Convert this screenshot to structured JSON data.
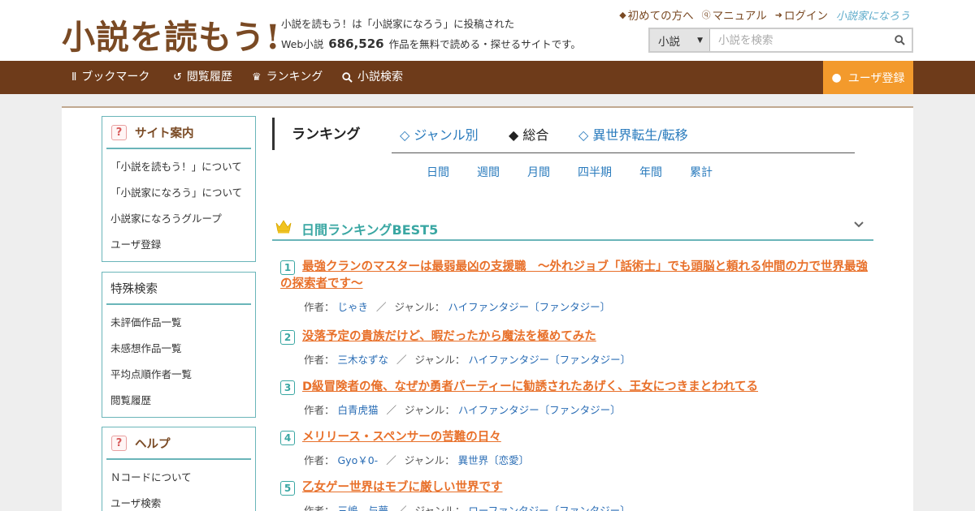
{
  "header": {
    "logo": "小説を読もう!",
    "tagline_line1": "小説を読もう！は「小説家になろう」に投稿された",
    "tagline_prefix": "Web小説",
    "tagline_count": "686,526",
    "tagline_suffix": "作品を無料で読める・探せるサイトです。",
    "toplinks": [
      {
        "label": "初めての方へ",
        "icon": "shield-icon"
      },
      {
        "label": "マニュアル",
        "icon": "question-icon"
      },
      {
        "label": "ログイン",
        "icon": "login-icon"
      }
    ],
    "narou_logo": "小説家になろう",
    "search": {
      "select_value": "小説",
      "placeholder": "小説を検索"
    }
  },
  "nav": {
    "items": [
      {
        "label": "ブックマーク",
        "icon": "bookmark-icon"
      },
      {
        "label": "閲覧履歴",
        "icon": "history-icon"
      },
      {
        "label": "ランキング",
        "icon": "crown-icon"
      },
      {
        "label": "小説検索",
        "icon": "search-icon"
      }
    ],
    "register": "ユーザ登録"
  },
  "sidebar": {
    "boxes": [
      {
        "title": "サイト案内",
        "items": [
          "「小説を読もう！」について",
          "「小説家になろう」について",
          "小説家になろうグループ",
          "ユーザ登録"
        ]
      },
      {
        "title": "特殊検索",
        "items": [
          "未評価作品一覧",
          "未感想作品一覧",
          "平均点順作者一覧",
          "閲覧履歴"
        ]
      },
      {
        "title": "ヘルプ",
        "items": [
          "Ｎコードについて",
          "ユーザ検索"
        ]
      }
    ]
  },
  "content": {
    "title": "ランキング",
    "tabs": [
      {
        "label": "◇ ジャンル別",
        "active": false
      },
      {
        "label": "◆ 総合",
        "active": true
      },
      {
        "label": "◇ 異世界転生/転移",
        "active": false
      }
    ],
    "periods": [
      "日間",
      "週間",
      "月間",
      "四半期",
      "年間",
      "累計"
    ],
    "ranking_title": "日間ランキングBEST5",
    "author_label": "作者：",
    "genre_label": "ジャンル：",
    "entries": [
      {
        "rank": "1",
        "title": "最強クランのマスターは最弱最凶の支援職　～外れジョブ「話術士」でも頭脳と頼れる仲間の力で世界最強の探索者です～",
        "author": "じゃき",
        "genre": "ハイファンタジー〔ファンタジー〕"
      },
      {
        "rank": "2",
        "title": "没落予定の貴族だけど、暇だったから魔法を極めてみた",
        "author": "三木なずな",
        "genre": "ハイファンタジー〔ファンタジー〕"
      },
      {
        "rank": "3",
        "title": "D級冒険者の俺、なぜか勇者パーティーに勧誘されたあげく、王女につきまとわれてる",
        "author": "白青虎猫",
        "genre": "ハイファンタジー〔ファンタジー〕"
      },
      {
        "rank": "4",
        "title": "メリリース・スペンサーの苦難の日々",
        "author": "Gyo￥0-",
        "genre": "異世界〔恋愛〕"
      },
      {
        "rank": "5",
        "title": "乙女ゲー世界はモブに厳しい世界です",
        "author": "三嶋　与夢",
        "genre": "ローファンタジー〔ファンタジー〕"
      }
    ]
  },
  "colors": {
    "brand_brown": "#6e3b1a",
    "accent_orange": "#f39a2c",
    "teal": "#3aa7a3",
    "title_orange": "#e8702a",
    "link_blue": "#2a7bbd"
  }
}
